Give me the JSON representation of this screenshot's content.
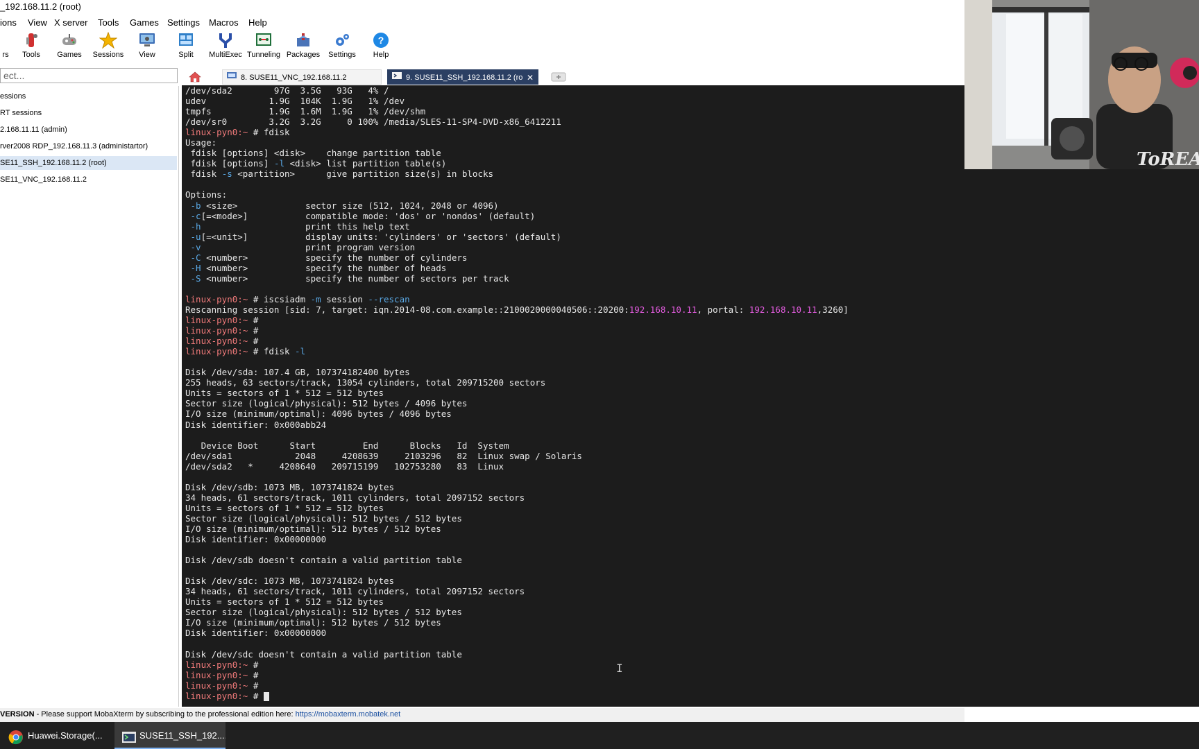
{
  "window": {
    "title": "_192.168.11.2 (root)"
  },
  "menu": [
    "ions",
    "View",
    "X server",
    "Tools",
    "Games",
    "Settings",
    "Macros",
    "Help"
  ],
  "toolbar": [
    {
      "label": "rs",
      "icon": "partial-icon"
    },
    {
      "label": "Tools",
      "icon": "tools-icon"
    },
    {
      "label": "Games",
      "icon": "gamepad-icon"
    },
    {
      "label": "Sessions",
      "icon": "star-icon"
    },
    {
      "label": "View",
      "icon": "monitor-icon"
    },
    {
      "label": "Split",
      "icon": "split-icon"
    },
    {
      "label": "MultiExec",
      "icon": "fork-icon"
    },
    {
      "label": "Tunneling",
      "icon": "tunnel-icon"
    },
    {
      "label": "Packages",
      "icon": "package-icon"
    },
    {
      "label": "Settings",
      "icon": "gears-icon"
    },
    {
      "label": "Help",
      "icon": "help-icon"
    }
  ],
  "search": {
    "placeholder": "ect..."
  },
  "sidebar": {
    "items": [
      {
        "label": "essions"
      },
      {
        "label": "RT sessions"
      },
      {
        "label": "2.168.11.11 (admin)"
      },
      {
        "label": "rver2008 RDP_192.168.11.3 (administartor)"
      },
      {
        "label": "SE11_SSH_192.168.11.2 (root)",
        "selected": true
      },
      {
        "label": "SE11_VNC_192.168.11.2"
      }
    ]
  },
  "tabs": [
    {
      "label": "8. SUSE11_VNC_192.168.11.2",
      "active": false
    },
    {
      "label": "9. SUSE11_SSH_192.168.11.2 (ro",
      "active": true
    }
  ],
  "terminal": {
    "lines": [
      [
        {
          "t": "/dev/sda2        97G  3.5G   93G   4% /"
        }
      ],
      [
        {
          "t": "udev            1.9G  104K  1.9G   1% /dev"
        }
      ],
      [
        {
          "t": "tmpfs           1.9G  1.6M  1.9G   1% /dev/shm"
        }
      ],
      [
        {
          "t": "/dev/sr0        3.2G  3.2G     0 100% /media/SLES-11-SP4-DVD-x86_6412211"
        }
      ],
      [
        {
          "t": "linux-pyn0:~",
          "c": "pr"
        },
        {
          "t": " # fdisk"
        }
      ],
      [
        {
          "t": "Usage:"
        }
      ],
      [
        {
          "t": " fdisk [options] <disk>    change partition table"
        }
      ],
      [
        {
          "t": " fdisk [options] "
        },
        {
          "t": "-l",
          "c": "opt"
        },
        {
          "t": " <disk> list partition table(s)"
        }
      ],
      [
        {
          "t": " fdisk "
        },
        {
          "t": "-s",
          "c": "opt"
        },
        {
          "t": " <partition>      give partition size(s) in blocks"
        }
      ],
      [
        {
          "t": ""
        }
      ],
      [
        {
          "t": "Options:"
        }
      ],
      [
        {
          "t": " "
        },
        {
          "t": "-b",
          "c": "opt"
        },
        {
          "t": " <size>             sector size (512, 1024, 2048 or 4096)"
        }
      ],
      [
        {
          "t": " "
        },
        {
          "t": "-c",
          "c": "opt"
        },
        {
          "t": "[=<mode>]           compatible mode: 'dos' or 'nondos' (default)"
        }
      ],
      [
        {
          "t": " "
        },
        {
          "t": "-h",
          "c": "opt"
        },
        {
          "t": "                    print this help text"
        }
      ],
      [
        {
          "t": " "
        },
        {
          "t": "-u",
          "c": "opt"
        },
        {
          "t": "[=<unit>]           display units: 'cylinders' or 'sectors' (default)"
        }
      ],
      [
        {
          "t": " "
        },
        {
          "t": "-v",
          "c": "opt"
        },
        {
          "t": "                    print program version"
        }
      ],
      [
        {
          "t": " "
        },
        {
          "t": "-C",
          "c": "opt"
        },
        {
          "t": " <number>           specify the number of cylinders"
        }
      ],
      [
        {
          "t": " "
        },
        {
          "t": "-H",
          "c": "opt"
        },
        {
          "t": " <number>           specify the number of heads"
        }
      ],
      [
        {
          "t": " "
        },
        {
          "t": "-S",
          "c": "opt"
        },
        {
          "t": " <number>           specify the number of sectors per track"
        }
      ],
      [
        {
          "t": ""
        }
      ],
      [
        {
          "t": "linux-pyn0:~",
          "c": "pr"
        },
        {
          "t": " # iscsiadm "
        },
        {
          "t": "-m",
          "c": "opt"
        },
        {
          "t": " session "
        },
        {
          "t": "--rescan",
          "c": "opt"
        }
      ],
      [
        {
          "t": "Rescanning session [sid: 7, target: iqn.2014-08.com.example::2100020000040506::20200:"
        },
        {
          "t": "192.168.10.11",
          "c": "ip"
        },
        {
          "t": ", portal: "
        },
        {
          "t": "192.168.10.11",
          "c": "ip"
        },
        {
          "t": ",3260]"
        }
      ],
      [
        {
          "t": "linux-pyn0:~",
          "c": "pr"
        },
        {
          "t": " #"
        }
      ],
      [
        {
          "t": "linux-pyn0:~",
          "c": "pr"
        },
        {
          "t": " #"
        }
      ],
      [
        {
          "t": "linux-pyn0:~",
          "c": "pr"
        },
        {
          "t": " #"
        }
      ],
      [
        {
          "t": "linux-pyn0:~",
          "c": "pr"
        },
        {
          "t": " # fdisk "
        },
        {
          "t": "-l",
          "c": "opt"
        }
      ],
      [
        {
          "t": ""
        }
      ],
      [
        {
          "t": "Disk /dev/sda: 107.4 GB, 107374182400 bytes"
        }
      ],
      [
        {
          "t": "255 heads, 63 sectors/track, 13054 cylinders, total 209715200 sectors"
        }
      ],
      [
        {
          "t": "Units = sectors of 1 * 512 = 512 bytes"
        }
      ],
      [
        {
          "t": "Sector size (logical/physical): 512 bytes / 4096 bytes"
        }
      ],
      [
        {
          "t": "I/O size (minimum/optimal): 4096 bytes / 4096 bytes"
        }
      ],
      [
        {
          "t": "Disk identifier: 0x000abb24"
        }
      ],
      [
        {
          "t": ""
        }
      ],
      [
        {
          "t": "   Device Boot      Start         End      Blocks   Id  System"
        }
      ],
      [
        {
          "t": "/dev/sda1            2048     4208639     2103296   82  Linux swap / Solaris"
        }
      ],
      [
        {
          "t": "/dev/sda2   *     4208640   209715199   102753280   83  Linux"
        }
      ],
      [
        {
          "t": ""
        }
      ],
      [
        {
          "t": "Disk /dev/sdb: 1073 MB, 1073741824 bytes"
        }
      ],
      [
        {
          "t": "34 heads, 61 sectors/track, 1011 cylinders, total 2097152 sectors"
        }
      ],
      [
        {
          "t": "Units = sectors of 1 * 512 = 512 bytes"
        }
      ],
      [
        {
          "t": "Sector size (logical/physical): 512 bytes / 512 bytes"
        }
      ],
      [
        {
          "t": "I/O size (minimum/optimal): 512 bytes / 512 bytes"
        }
      ],
      [
        {
          "t": "Disk identifier: 0x00000000"
        }
      ],
      [
        {
          "t": ""
        }
      ],
      [
        {
          "t": "Disk /dev/sdb doesn't contain a valid partition table"
        }
      ],
      [
        {
          "t": ""
        }
      ],
      [
        {
          "t": "Disk /dev/sdc: 1073 MB, 1073741824 bytes"
        }
      ],
      [
        {
          "t": "34 heads, 61 sectors/track, 1011 cylinders, total 2097152 sectors"
        }
      ],
      [
        {
          "t": "Units = sectors of 1 * 512 = 512 bytes"
        }
      ],
      [
        {
          "t": "Sector size (logical/physical): 512 bytes / 512 bytes"
        }
      ],
      [
        {
          "t": "I/O size (minimum/optimal): 512 bytes / 512 bytes"
        }
      ],
      [
        {
          "t": "Disk identifier: 0x00000000"
        }
      ],
      [
        {
          "t": ""
        }
      ],
      [
        {
          "t": "Disk /dev/sdc doesn't contain a valid partition table"
        }
      ],
      [
        {
          "t": "linux-pyn0:~",
          "c": "pr"
        },
        {
          "t": " #"
        }
      ],
      [
        {
          "t": "linux-pyn0:~",
          "c": "pr"
        },
        {
          "t": " #"
        }
      ],
      [
        {
          "t": "linux-pyn0:~",
          "c": "pr"
        },
        {
          "t": " #"
        }
      ],
      [
        {
          "t": "linux-pyn0:~",
          "c": "pr"
        },
        {
          "t": " # "
        }
      ]
    ]
  },
  "statusbar": {
    "edition": "VERSION",
    "message": " - Please support MobaXterm by subscribing to the professional edition here: ",
    "link": "https://mobaxterm.mobatek.net"
  },
  "taskbar": [
    {
      "label": "Huawei.Storage(...",
      "icon": "chrome-icon"
    },
    {
      "label": "SUSE11_SSH_192....",
      "icon": "mobaxterm-icon"
    }
  ],
  "webcam": {
    "shirt_text": "ToREAD"
  },
  "colors": {
    "terminal_bg": "#1c1c1c",
    "terminal_fg": "#e8e8e8",
    "prompt": "#f07a7a",
    "option": "#5aa9e6",
    "ip": "#e45ce0",
    "selection": "#dbe7f5"
  }
}
